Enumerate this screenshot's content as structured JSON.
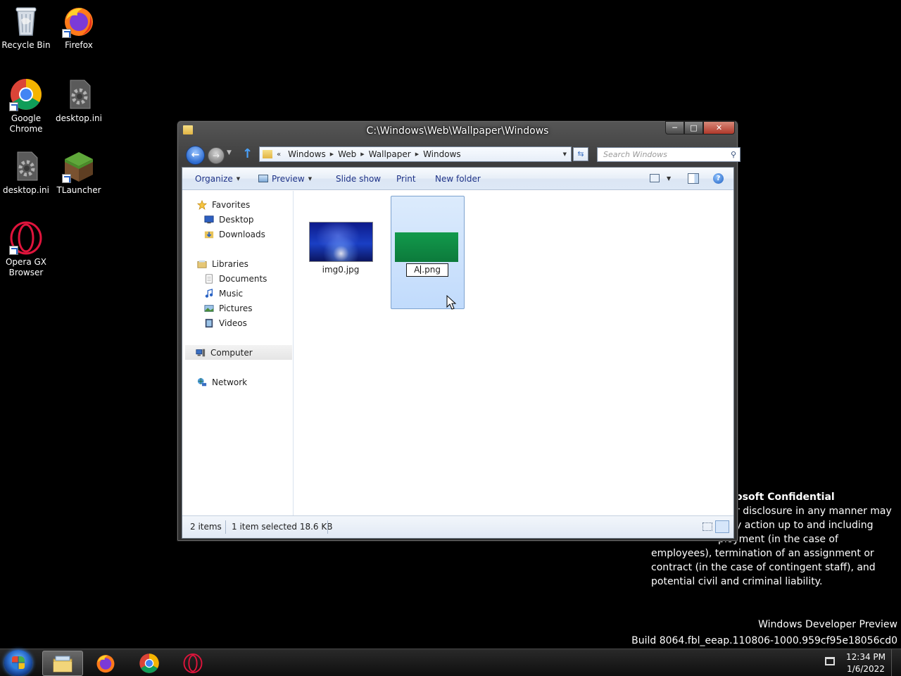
{
  "desktop": {
    "icons": [
      {
        "label": "Recycle Bin",
        "icon": "recycle-bin-icon"
      },
      {
        "label": "Firefox",
        "icon": "firefox-icon"
      },
      {
        "label": "Google Chrome",
        "icon": "chrome-icon"
      },
      {
        "label": "desktop.ini",
        "icon": "settings-file-icon"
      },
      {
        "label": "desktop.ini",
        "icon": "settings-file-icon"
      },
      {
        "label": "TLauncher",
        "icon": "tlauncher-icon"
      },
      {
        "label": "Opera GX Browser",
        "icon": "opera-gx-icon"
      }
    ]
  },
  "watermark": {
    "title": "osoft Confidential",
    "lines": [
      "r disclosure in any manner may",
      "y action up to and including",
      "ployment (in the case of",
      "employees), termination of an assignment or",
      "contract (in the case of contingent staff), and",
      "potential civil and criminal liability."
    ],
    "product": "Windows Developer Preview",
    "build": "Build 8064.fbl_eeap.110806-1000.959cf95e18056cd0"
  },
  "window": {
    "title": "C:\\Windows\\Web\\Wallpaper\\Windows",
    "caption": {
      "minimize": "─",
      "maximize": "□",
      "close": "✕"
    },
    "address": {
      "chevron": "«",
      "segments": [
        "Windows",
        "Web",
        "Wallpaper",
        "Windows"
      ]
    },
    "search_placeholder": "Search Windows",
    "toolbar": {
      "organize": "Organize",
      "preview": "Preview",
      "slideshow": "Slide show",
      "print": "Print",
      "new_folder": "New folder"
    },
    "nav": {
      "favorites": "Favorites",
      "desktop": "Desktop",
      "downloads": "Downloads",
      "libraries": "Libraries",
      "documents": "Documents",
      "music": "Music",
      "pictures": "Pictures",
      "videos": "Videos",
      "computer": "Computer",
      "network": "Network"
    },
    "files": [
      {
        "name": "img0.jpg"
      },
      {
        "name_before_caret": "A",
        "name_after_caret": ".png"
      }
    ],
    "status": {
      "count": "2 items",
      "selected": "1 item selected  18.6 KB"
    }
  },
  "taskbar": {
    "apps": [
      "explorer-icon",
      "firefox-icon",
      "chrome-icon",
      "opera-gx-icon"
    ],
    "time": "12:34 PM",
    "date": "1/6/2022"
  },
  "colors": {
    "desktop_bg": "#000000",
    "selection": "#cce2fc",
    "green_thumb": "#129a4c",
    "blue_thumb": "#1a3fc4"
  }
}
